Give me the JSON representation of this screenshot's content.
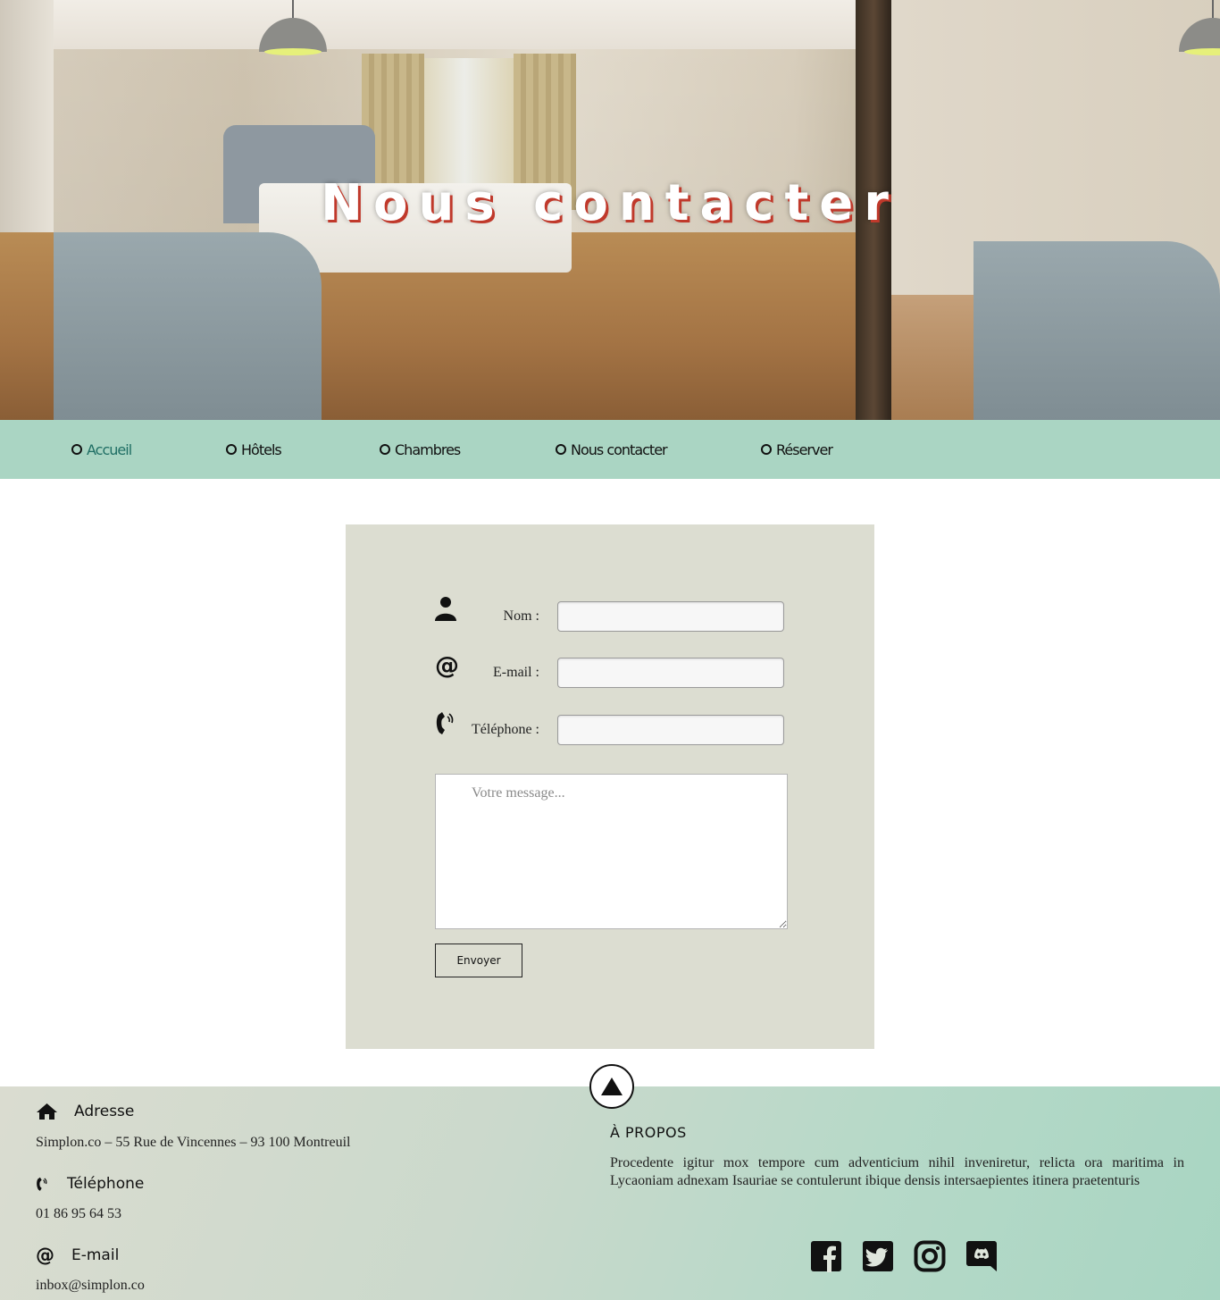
{
  "hero": {
    "title": "Nous contacter"
  },
  "nav": {
    "items": [
      {
        "label": "Accueil",
        "active": true
      },
      {
        "label": "Hôtels"
      },
      {
        "label": "Chambres"
      },
      {
        "label": "Nous contacter"
      },
      {
        "label": "Réserver"
      }
    ]
  },
  "form": {
    "name_label": "Nom :",
    "email_label": "E-mail :",
    "phone_label": "Téléphone :",
    "name_value": "",
    "email_value": "",
    "phone_value": "",
    "message_placeholder": "Votre message...",
    "submit_label": "Envoyer"
  },
  "footer": {
    "address_title": "Adresse",
    "address": "Simplon.co – 55 Rue de Vincennes – 93 100 Montreuil",
    "phone_title": "Téléphone",
    "phone": "01 86 95 64 53",
    "email_title": "E-mail",
    "email": "inbox@simplon.co",
    "about_title": "À PROPOS",
    "about_text": "Procedente igitur mox tempore cum adventicium nihil inveniretur, relicta ora maritima in Lycaoniam adnexam Isauriae se contulerunt ibique densis intersaepientes itinera praetenturis",
    "social": [
      "facebook-icon",
      "twitter-icon",
      "instagram-icon",
      "discord-icon"
    ]
  },
  "colors": {
    "nav_bg": "#aad5c3",
    "card_bg": "#dcddd1",
    "active_link": "#1f6e64",
    "title_shadow": "#c0392b"
  }
}
